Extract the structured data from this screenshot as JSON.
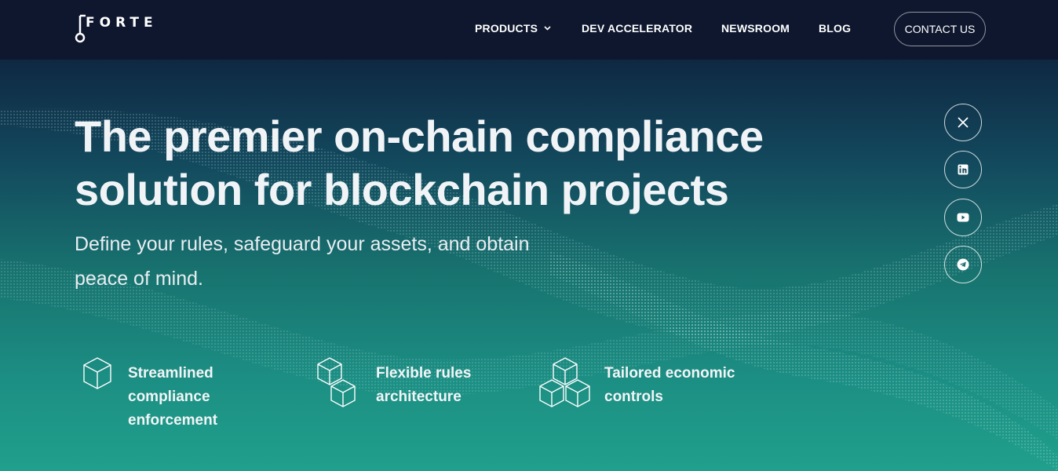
{
  "brand": {
    "logo_text": "FORTE"
  },
  "nav": {
    "items": [
      {
        "label": "PRODUCTS",
        "has_dropdown": true
      },
      {
        "label": "DEV ACCELERATOR"
      },
      {
        "label": "NEWSROOM"
      },
      {
        "label": "BLOG"
      }
    ],
    "contact_label": "CONTACT US"
  },
  "hero": {
    "title_line1": "The premier on-chain compliance",
    "title_line2": "solution for blockchain projects",
    "subtitle_line1": "Define your rules, safeguard your assets, and obtain",
    "subtitle_line2": "peace of mind."
  },
  "social": [
    {
      "icon": "x-icon"
    },
    {
      "icon": "linkedin-icon"
    },
    {
      "icon": "youtube-icon"
    },
    {
      "icon": "telegram-icon"
    }
  ],
  "features": [
    {
      "icon": "single-cube-icon",
      "lines": [
        "Streamlined",
        "compliance",
        "enforcement"
      ]
    },
    {
      "icon": "two-cubes-icon",
      "lines": [
        "Flexible rules",
        "architecture"
      ]
    },
    {
      "icon": "three-cubes-icon",
      "lines": [
        "Tailored economic",
        "controls"
      ]
    }
  ],
  "colors": {
    "header_bg": "#0e172e",
    "gradient_top": "#0f2a44",
    "gradient_bottom": "#20a08c",
    "text": "#ffffff"
  }
}
